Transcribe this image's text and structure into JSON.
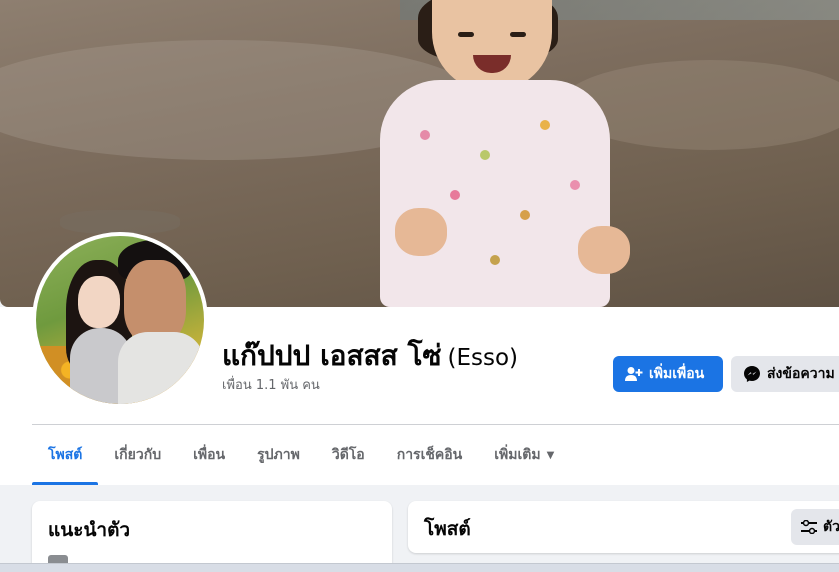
{
  "profile": {
    "name": "แก๊ปปป เอสสส โซ่",
    "alternate_name": "(Esso)",
    "friend_count": "เพื่อน 1.1 พัน คน"
  },
  "actions": {
    "add_friend_label": "เพิ่มเพื่อน",
    "message_label": "ส่งข้อความ"
  },
  "tabs": [
    {
      "label": "โพสต์",
      "active": true
    },
    {
      "label": "เกี่ยวกับ",
      "active": false
    },
    {
      "label": "เพื่อน",
      "active": false
    },
    {
      "label": "รูปภาพ",
      "active": false
    },
    {
      "label": "วิดีโอ",
      "active": false
    },
    {
      "label": "การเช็คอิน",
      "active": false
    },
    {
      "label": "เพิ่มเติม",
      "active": false
    }
  ],
  "intro": {
    "title": "แนะนำตัว"
  },
  "posts": {
    "title": "โพสต์",
    "filter_label": "ตัว"
  },
  "icons": {
    "add_friend": "person-plus-icon",
    "message": "messenger-icon",
    "more_caret": "caret-down-icon",
    "filter": "sliders-icon"
  },
  "colors": {
    "accent": "#1b74e4",
    "secondary_button": "#e4e6eb",
    "page_background": "#f0f2f5",
    "muted_text": "#65676b"
  }
}
